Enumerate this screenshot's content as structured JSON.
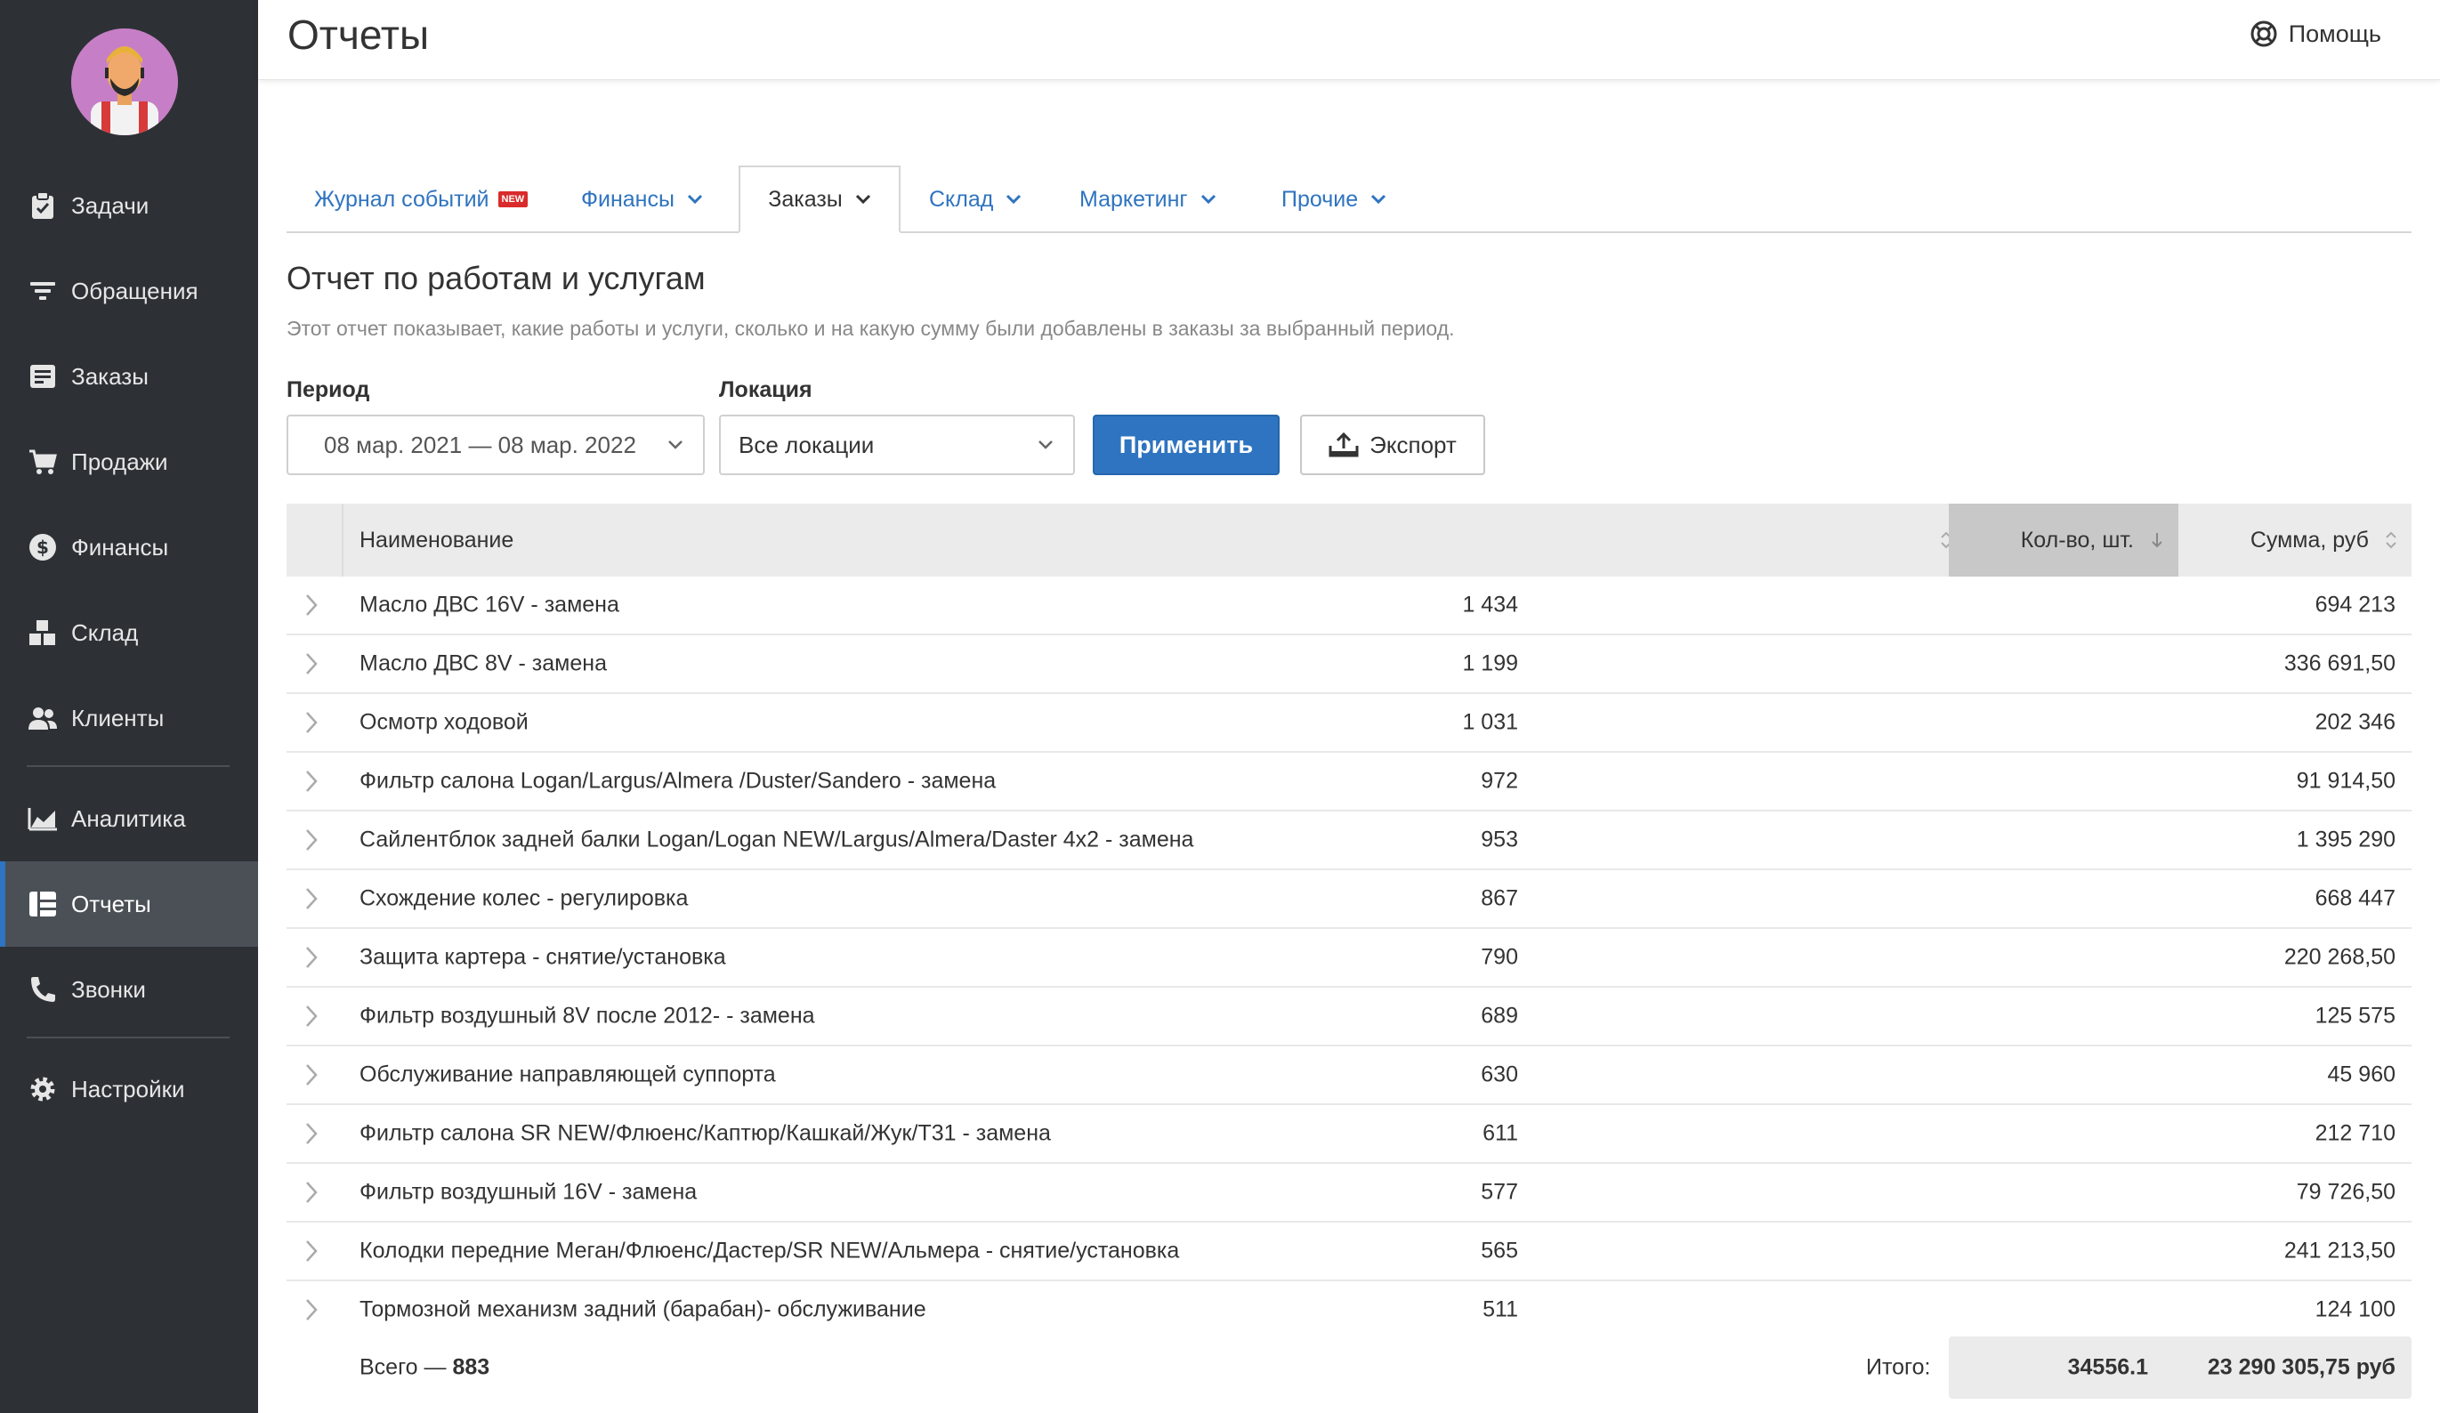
{
  "sidebar": {
    "items": [
      {
        "label": "Задачи",
        "icon": "clipboard-check-icon"
      },
      {
        "label": "Обращения",
        "icon": "filter-icon"
      },
      {
        "label": "Заказы",
        "icon": "order-card-icon"
      },
      {
        "label": "Продажи",
        "icon": "cart-icon"
      },
      {
        "label": "Финансы",
        "icon": "dollar-icon"
      },
      {
        "label": "Склад",
        "icon": "boxes-icon"
      },
      {
        "label": "Клиенты",
        "icon": "users-icon"
      },
      {
        "label": "Аналитика",
        "icon": "area-chart-icon"
      },
      {
        "label": "Отчеты",
        "icon": "table-icon"
      },
      {
        "label": "Звонки",
        "icon": "phone-icon"
      },
      {
        "label": "Настройки",
        "icon": "gear-icon"
      }
    ],
    "active": "Отчеты"
  },
  "header": {
    "title": "Отчеты",
    "help_label": "Помощь"
  },
  "tabs": [
    {
      "label": "Журнал событий",
      "badge": "NEW"
    },
    {
      "label": "Финансы"
    },
    {
      "label": "Заказы"
    },
    {
      "label": "Склад"
    },
    {
      "label": "Маркетинг"
    },
    {
      "label": "Прочие"
    }
  ],
  "report": {
    "title": "Отчет по работам и услугам",
    "description": "Этот отчет показывает, какие работы и услуги, сколько и на какую сумму были добавлены в заказы за выбранный период."
  },
  "filters": {
    "period_label": "Период",
    "period_value": "08 мар. 2021 — 08 мар. 2022",
    "location_label": "Локация",
    "location_value": "Все локации",
    "apply_label": "Применить",
    "export_label": "Экспорт"
  },
  "table": {
    "columns": {
      "name": "Наименование",
      "qty": "Кол-во, шт.",
      "sum": "Сумма, руб"
    },
    "rows": [
      {
        "name": "Масло ДВС 16V - замена",
        "qty": "1 434",
        "sum": "694 213"
      },
      {
        "name": "Масло ДВС 8V - замена",
        "qty": "1 199",
        "sum": "336 691,50"
      },
      {
        "name": "Осмотр ходовой",
        "qty": "1 031",
        "sum": "202 346"
      },
      {
        "name": "Фильтр салона Logan/Largus/Almera /Duster/Sandero - замена",
        "qty": "972",
        "sum": "91 914,50"
      },
      {
        "name": "Сайлентблок задней балки Logan/Logan NEW/Largus/Almera/Daster 4x2 - замена",
        "qty": "953",
        "sum": "1 395 290"
      },
      {
        "name": "Схождение колес - регулировка",
        "qty": "867",
        "sum": "668 447"
      },
      {
        "name": "Защита картера - снятие/установка",
        "qty": "790",
        "sum": "220 268,50"
      },
      {
        "name": "Фильтр воздушный 8V после 2012- - замена",
        "qty": "689",
        "sum": "125 575"
      },
      {
        "name": "Обслуживание направляющей суппорта",
        "qty": "630",
        "sum": "45 960"
      },
      {
        "name": "Фильтр салона SR NEW/Флюенс/Каптюр/Кашкай/Жук/Т31 - замена",
        "qty": "611",
        "sum": "212 710"
      },
      {
        "name": "Фильтр воздушный 16V - замена",
        "qty": "577",
        "sum": "79 726,50"
      },
      {
        "name": "Колодки передние Меган/Флюенс/Дастер/SR NEW/Альмера - снятие/установка",
        "qty": "565",
        "sum": "241 213,50"
      },
      {
        "name": "Тормозной механизм задний (барабан)- обслуживание",
        "qty": "511",
        "sum": "124 100"
      }
    ],
    "footer": {
      "total_label": "Всего — ",
      "total_count": "883",
      "itogo_label": "Итого:",
      "itogo_qty": "34556.1",
      "itogo_sum": "23 290 305,75 руб"
    }
  },
  "colors": {
    "sidebar_bg": "#2d3135",
    "accent": "#2f74c0",
    "badge_new": "#d92b2b"
  }
}
